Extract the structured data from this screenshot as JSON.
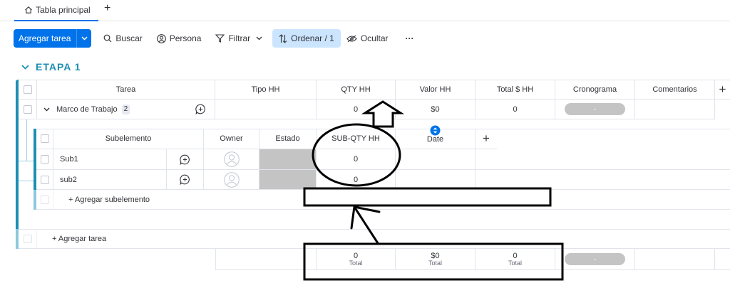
{
  "tabs": {
    "main": "Tabla principal",
    "add": "+"
  },
  "toolbar": {
    "new_task": "Agregar tarea",
    "search": "Buscar",
    "person": "Persona",
    "filter": "Filtrar",
    "sort": "Ordenar / 1",
    "hide": "Ocultar",
    "more": "···"
  },
  "group": {
    "title": "ETAPA 1",
    "color": "#1b8fb4",
    "columns": [
      "Tarea",
      "Tipo HH",
      "QTY HH",
      "Valor HH",
      "Total $ HH",
      "Cronograma",
      "Comentarios"
    ],
    "add_column": "+",
    "item": {
      "name": "Marco de Trabajo",
      "subitem_count": "2",
      "qty": "0",
      "valor": "$0",
      "total": "0",
      "timeline": "-"
    },
    "subitems": {
      "columns": [
        "Subelemento",
        "Owner",
        "Estado",
        "SUB-QTY HH",
        "Date"
      ],
      "add_column": "+",
      "rows": [
        {
          "name": "Sub1",
          "qty": "0"
        },
        {
          "name": "sub2",
          "qty": "0"
        }
      ],
      "add_label": "+ Agregar subelemento"
    },
    "add_task": "+ Agregar tarea",
    "summary": {
      "qty": "0",
      "valor": "$0",
      "total": "0",
      "total_label": "Total",
      "timeline": "-"
    }
  }
}
